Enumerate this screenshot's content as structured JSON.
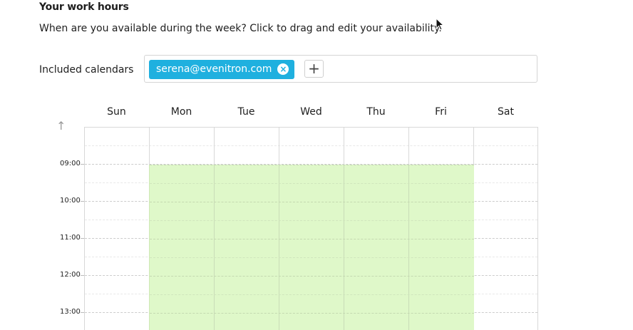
{
  "header": {
    "title": "Your work hours",
    "description": "When are you available during the week? Click to drag and edit your availability."
  },
  "calendars": {
    "label": "Included calendars",
    "items": [
      {
        "email": "serena@evenitron.com",
        "remove_symbol": "×"
      }
    ],
    "add_symbol": "+",
    "chip_color": "#1fb0df"
  },
  "schedule": {
    "scroll_up_symbol": "↑",
    "days": [
      "Sun",
      "Mon",
      "Tue",
      "Wed",
      "Thu",
      "Fri",
      "Sat"
    ],
    "time_labels": [
      "09:00",
      "10:00",
      "11:00",
      "12:00",
      "13:00"
    ],
    "availability": {
      "days": [
        "Mon",
        "Tue",
        "Wed",
        "Thu",
        "Fri"
      ],
      "start": "09:00",
      "color": "#dff8c9"
    }
  },
  "icons": {
    "remove": "close-circle-icon",
    "add": "plus-icon",
    "scroll": "arrow-up-icon",
    "cursor": "mouse-pointer-icon"
  }
}
